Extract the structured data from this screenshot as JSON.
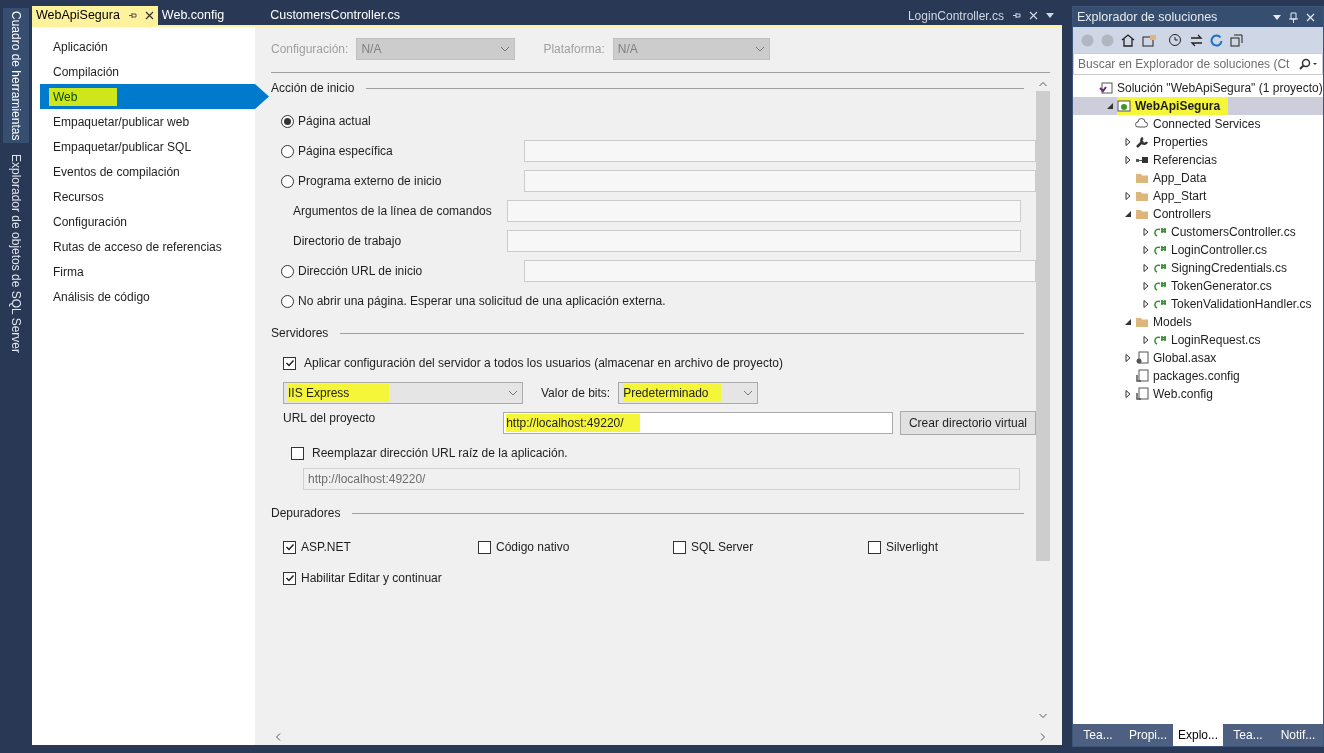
{
  "side_tabs": [
    {
      "label": "Cuadro de herramientas",
      "selected": true
    },
    {
      "label": "Explorador de objetos de SQL Server",
      "selected": false
    }
  ],
  "tabs": [
    {
      "label": "WebApiSegura",
      "selected": true
    },
    {
      "label": "Web.config",
      "selected": false
    },
    {
      "label": "CustomersController.cs",
      "selected": false
    }
  ],
  "right_tab": {
    "label": "LoginController.cs"
  },
  "nav": [
    {
      "label": "Aplicación",
      "selected": false,
      "highlighted": false
    },
    {
      "label": "Compilación",
      "selected": false,
      "highlighted": false
    },
    {
      "label": "Web",
      "selected": true,
      "highlighted": true
    },
    {
      "label": "Empaquetar/publicar web",
      "selected": false,
      "highlighted": false
    },
    {
      "label": "Empaquetar/publicar SQL",
      "selected": false,
      "highlighted": false
    },
    {
      "label": "Eventos de compilación",
      "selected": false,
      "highlighted": false
    },
    {
      "label": "Recursos",
      "selected": false,
      "highlighted": false
    },
    {
      "label": "Configuración",
      "selected": false,
      "highlighted": false
    },
    {
      "label": "Rutas de acceso de referencias",
      "selected": false,
      "highlighted": false
    },
    {
      "label": "Firma",
      "selected": false,
      "highlighted": false
    },
    {
      "label": "Análisis de código",
      "selected": false,
      "highlighted": false
    }
  ],
  "config": {
    "config_label": "Configuración:",
    "config_value": "N/A",
    "platform_label": "Plataforma:",
    "platform_value": "N/A",
    "disabled": true
  },
  "start_action": {
    "title": "Acción de inicio",
    "items": [
      {
        "kind": "radio",
        "label": "Página actual",
        "selected": true,
        "field": false
      },
      {
        "kind": "radio",
        "label": "Página específica",
        "selected": false,
        "field": true
      },
      {
        "kind": "radio",
        "label": "Programa externo de inicio",
        "selected": false,
        "field": true
      },
      {
        "kind": "field",
        "label": "Argumentos de la línea de comandos"
      },
      {
        "kind": "field",
        "label": "Directorio de trabajo"
      },
      {
        "kind": "radio",
        "label": "Dirección URL de inicio",
        "selected": false,
        "field": true
      },
      {
        "kind": "radio",
        "label": "No abrir una página. Esperar una solicitud de una aplicación externa.",
        "selected": false,
        "field": false
      }
    ]
  },
  "servers": {
    "title": "Servidores",
    "apply": {
      "label": "Aplicar configuración del servidor a todos los usuarios (almacenar en archivo de proyecto)",
      "checked": true
    },
    "server": {
      "value": "IIS Express",
      "highlighted": true
    },
    "bits_label": "Valor de bits:",
    "bits": {
      "value": "Predeterminado",
      "highlighted": true
    },
    "url_label": "URL del proyecto",
    "url": {
      "value": "http://localhost:49220/",
      "highlighted": true
    },
    "create_button": "Crear directorio virtual",
    "override": {
      "label": "Reemplazar dirección URL raíz de la aplicación.",
      "checked": false
    },
    "override_url": "http://localhost:49220/"
  },
  "debuggers": {
    "title": "Depuradores",
    "items": [
      {
        "label": "ASP.NET",
        "checked": true
      },
      {
        "label": "Código nativo",
        "checked": false
      },
      {
        "label": "SQL Server",
        "checked": false
      },
      {
        "label": "Silverlight",
        "checked": false
      }
    ],
    "edit_continue": {
      "label": "Habilitar Editar y continuar",
      "checked": true
    }
  },
  "explorer": {
    "title": "Explorador de soluciones",
    "search": {
      "placeholder": "Buscar en Explorador de soluciones (Ct"
    },
    "tree": [
      {
        "label": "Solución \"WebApiSegura\"  (1 proyecto)",
        "kind": "solution",
        "bold": false,
        "selected": false,
        "highlighted": false,
        "children": [
          {
            "label": "WebApiSegura",
            "kind": "web",
            "bold": true,
            "selected": true,
            "highlighted": true,
            "expanded": true,
            "children": [
              {
                "label": "Connected Services",
                "kind": "cloud",
                "bold": false,
                "selected": false,
                "highlighted": false
              },
              {
                "label": "Properties",
                "kind": "wrench",
                "bold": false,
                "selected": false,
                "highlighted": false,
                "expanded": false
              },
              {
                "label": "Referencias",
                "kind": "refs",
                "bold": false,
                "selected": false,
                "highlighted": false,
                "expanded": false
              },
              {
                "label": "App_Data",
                "kind": "folder",
                "bold": false,
                "selected": false,
                "highlighted": false
              },
              {
                "label": "App_Start",
                "kind": "folder",
                "bold": false,
                "selected": false,
                "highlighted": false,
                "expanded": false
              },
              {
                "label": "Controllers",
                "kind": "folder",
                "bold": false,
                "selected": false,
                "highlighted": false,
                "expanded": true,
                "children": [
                  {
                    "label": "CustomersController.cs",
                    "kind": "cs",
                    "bold": false,
                    "selected": false,
                    "highlighted": false,
                    "expanded": false
                  },
                  {
                    "label": "LoginController.cs",
                    "kind": "cs",
                    "bold": false,
                    "selected": false,
                    "highlighted": false,
                    "expanded": false
                  },
                  {
                    "label": "SigningCredentials.cs",
                    "kind": "cs",
                    "bold": false,
                    "selected": false,
                    "highlighted": false,
                    "expanded": false
                  },
                  {
                    "label": "TokenGenerator.cs",
                    "kind": "cs",
                    "bold": false,
                    "selected": false,
                    "highlighted": false,
                    "expanded": false
                  },
                  {
                    "label": "TokenValidationHandler.cs",
                    "kind": "cs",
                    "bold": false,
                    "selected": false,
                    "highlighted": false,
                    "expanded": false
                  }
                ]
              },
              {
                "label": "Models",
                "kind": "folder",
                "bold": false,
                "selected": false,
                "highlighted": false,
                "expanded": true,
                "children": [
                  {
                    "label": "LoginRequest.cs",
                    "kind": "cs",
                    "bold": false,
                    "selected": false,
                    "highlighted": false,
                    "expanded": false
                  }
                ]
              },
              {
                "label": "Global.asax",
                "kind": "asax",
                "bold": false,
                "selected": false,
                "highlighted": false,
                "expanded": false
              },
              {
                "label": "packages.config",
                "kind": "config",
                "bold": false,
                "selected": false,
                "highlighted": false
              },
              {
                "label": "Web.config",
                "kind": "config",
                "bold": false,
                "selected": false,
                "highlighted": false,
                "expanded": false
              }
            ]
          }
        ]
      }
    ]
  },
  "bottom_tabs": [
    {
      "label": "Tea...",
      "selected": false
    },
    {
      "label": "Propi...",
      "selected": false
    },
    {
      "label": "Explo...",
      "selected": true
    },
    {
      "label": "Tea...",
      "selected": false
    },
    {
      "label": "Notif...",
      "selected": false
    }
  ]
}
